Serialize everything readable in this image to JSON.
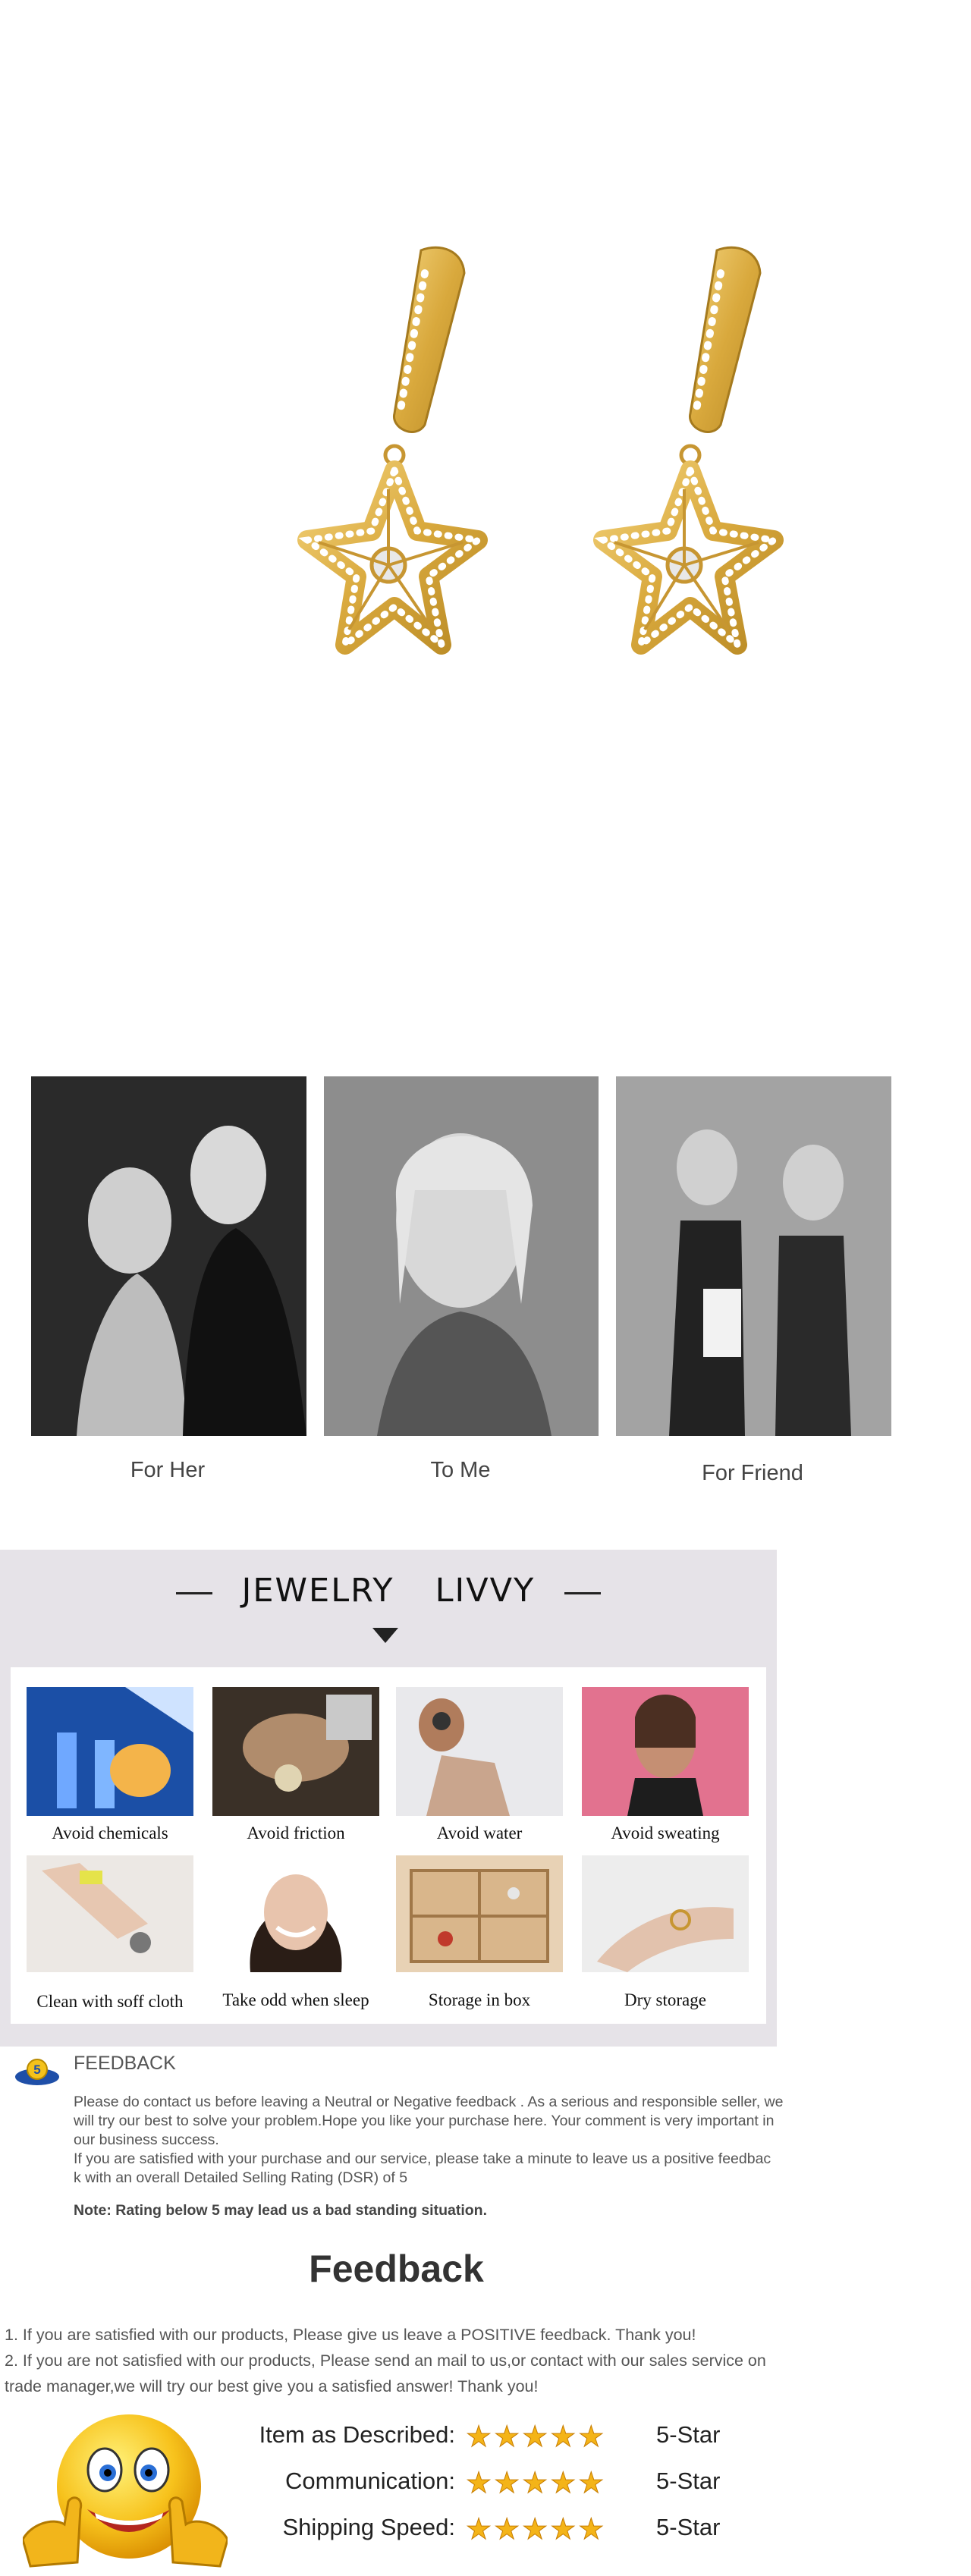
{
  "occasions": [
    {
      "label": "For Her"
    },
    {
      "label": "To Me"
    },
    {
      "label": "For Friend"
    }
  ],
  "care": {
    "brand_left": "JEWELRY",
    "brand_right": "LIVVY",
    "tips": [
      {
        "label": "Avoid chemicals"
      },
      {
        "label": "Avoid friction"
      },
      {
        "label": "Avoid water"
      },
      {
        "label": "Avoid sweating"
      },
      {
        "label": "Clean with soff cloth"
      },
      {
        "label": "Take odd when sleep"
      },
      {
        "label": "Storage in box"
      },
      {
        "label": "Dry storage"
      }
    ]
  },
  "feedback_notice": {
    "heading": "FEEDBACK",
    "badge": "5",
    "para1_line1": "Please do contact us before leaving a Neutral or Negative  feedback . As a serious and responsible seller, we",
    "para1_line2": "will try our best to solve your problem.Hope you like your purchase here. Your comment is very important in",
    "para1_line3": "our business success.",
    "para2_line1": " If you are satisfied with your purchase and our service,  please take a minute to leave us  a positive feedbac",
    "para2_line2": "k with an overall  Detailed Selling Rating (DSR) of 5",
    "note": "Note: Rating below 5 may lead us a bad standing situation."
  },
  "feedback": {
    "title": "Feedback",
    "line1": "1. If you are satisfied with our products, Please give us leave a POSITIVE feedback. Thank you!",
    "line2": "2. If you are not satisfied with our products, Please send an mail to us,or contact with our sales service on",
    "line3": "trade manager,we will try our best give you a satisfied answer! Thank you!"
  },
  "ratings": [
    {
      "label": "Item as Described:",
      "stars": "★★★★★",
      "value": "5-Star",
      "score": 5
    },
    {
      "label": "Communication:",
      "stars": "★★★★★",
      "value": "5-Star",
      "score": 5
    },
    {
      "label": "Shipping Speed:",
      "stars": "★★★★★",
      "value": "5-Star",
      "score": 5
    }
  ],
  "colors": {
    "gold": "#d9a93d",
    "care_bg": "#e6e3e8",
    "star": "#f4b418"
  }
}
